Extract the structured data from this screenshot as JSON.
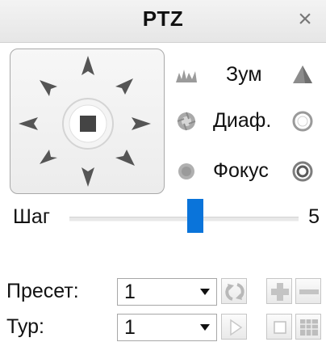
{
  "window": {
    "title": "PTZ",
    "close_symbol": "×"
  },
  "controls": {
    "zoom_label": "Зум",
    "iris_label": "Диаф.",
    "focus_label": "Фокус"
  },
  "step": {
    "label": "Шаг",
    "value": "5",
    "level_fraction": 0.55
  },
  "preset": {
    "label": "Пресет:",
    "selected": "1"
  },
  "tour": {
    "label": "Тур:",
    "selected": "1"
  },
  "colors": {
    "accent": "#0a74da",
    "arrow": "#555555"
  }
}
